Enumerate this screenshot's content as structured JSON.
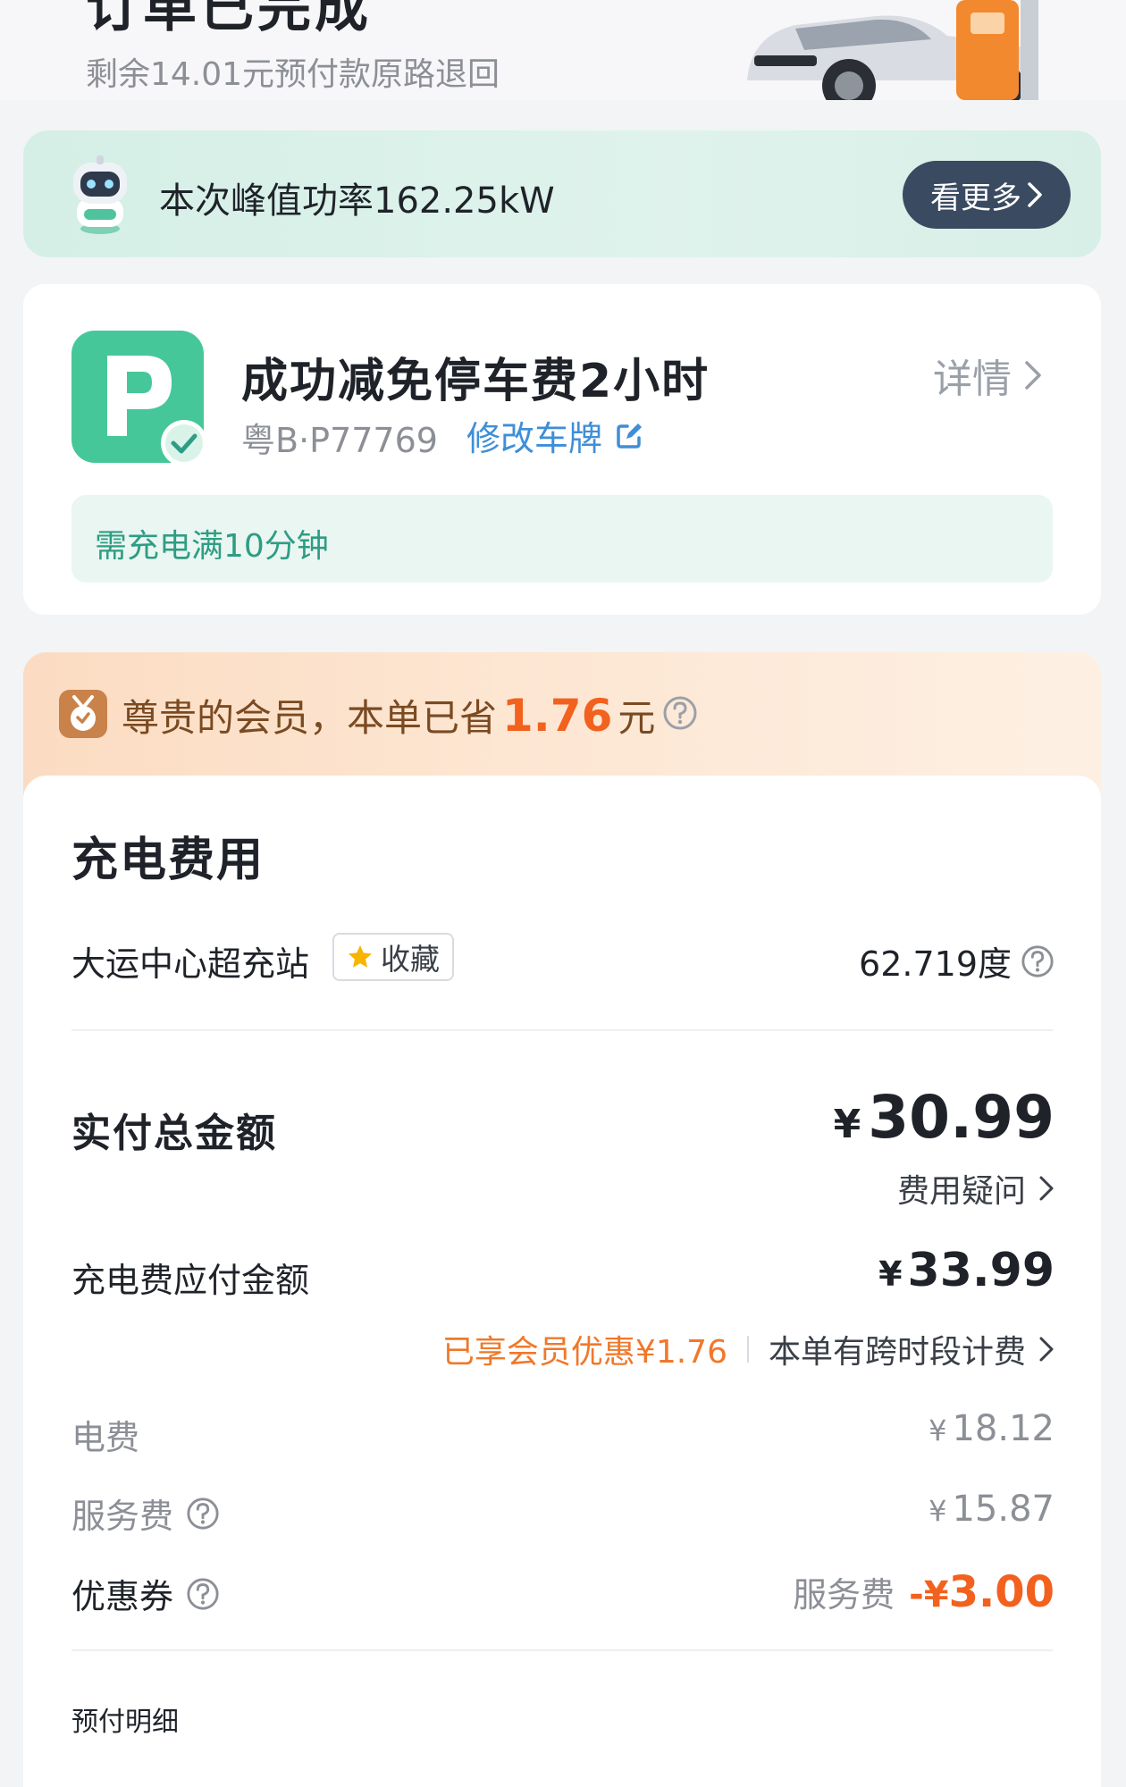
{
  "header": {
    "title": "订单已完成",
    "refund_note": "剩余14.01元预付款原路退回"
  },
  "peak_banner": {
    "text": "本次峰值功率162.25kW",
    "button_label": "看更多"
  },
  "parking": {
    "title": "成功减免停车费2小时",
    "plate": "粤B·P77769",
    "edit_label": "修改车牌",
    "detail_label": "详情",
    "requirement": "需充电满10分钟"
  },
  "member": {
    "prefix": "尊贵的会员，本单已省",
    "amount": "1.76",
    "suffix": "元"
  },
  "fee": {
    "title": "充电费用",
    "station": "大运中心超充站",
    "favorite_label": "收藏",
    "energy": "62.719度",
    "total_label": "实付总金额",
    "total_currency": "¥",
    "total_amount": "30.99",
    "question_label": "费用疑问",
    "payable_label": "充电费应付金额",
    "payable_currency": "¥",
    "payable_amount": "33.99",
    "member_discount": "已享会员优惠¥1.76",
    "timeslot_note": "本单有跨时段计费",
    "items": [
      {
        "label": "电费",
        "currency": "¥",
        "amount": "18.12"
      },
      {
        "label": "服务费",
        "currency": "¥",
        "amount": "15.87"
      }
    ],
    "coupon_label": "优惠券",
    "coupon_target": "服务费",
    "coupon_currency": "-¥",
    "coupon_amount": "3.00",
    "prepay_label": "预付明细"
  },
  "colors": {
    "accent_orange": "#f2611d",
    "teal": "#2e9d83",
    "link_blue": "#3f8ed8",
    "button_dark": "#3a4a60"
  }
}
